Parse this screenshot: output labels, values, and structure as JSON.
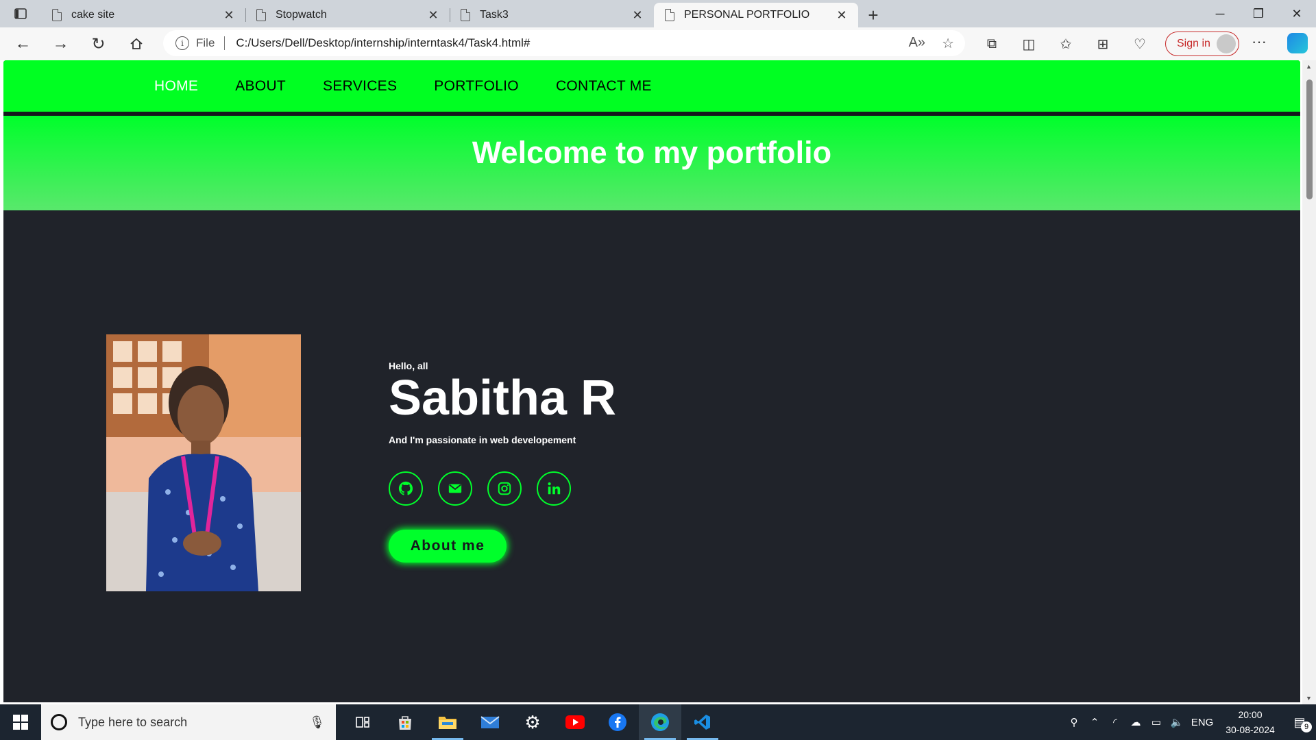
{
  "browser": {
    "tabs": [
      {
        "label": "cake site",
        "active": false
      },
      {
        "label": "Stopwatch",
        "active": false
      },
      {
        "label": "Task3",
        "active": false
      },
      {
        "label": "PERSONAL PORTFOLIO",
        "active": true
      }
    ],
    "address": {
      "scheme": "File",
      "url": "C:/Users/Dell/Desktop/internship/interntask4/Task4.html#"
    },
    "signin_label": "Sign in"
  },
  "site": {
    "nav": [
      "HOME",
      "ABOUT",
      "SERVICES",
      "PORTFOLIO",
      "CONTACT ME"
    ],
    "hero_title": "Welcome to my portfolio",
    "hello": "Hello, all",
    "name": "Sabitha R",
    "tagline": "And I'm passionate in web developement",
    "socials": [
      "github-icon",
      "mail-icon",
      "instagram-icon",
      "linkedin-icon"
    ],
    "about_button": "About me",
    "accent": "#00ff2b",
    "background": "#20232a"
  },
  "taskbar": {
    "search_placeholder": "Type here to search",
    "language": "ENG",
    "time": "20:00",
    "date": "30-08-2024",
    "notification_count": "9"
  }
}
